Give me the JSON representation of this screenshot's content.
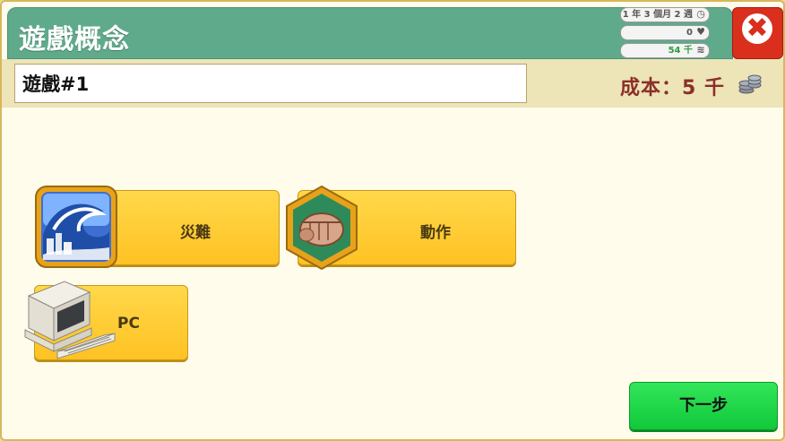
{
  "header": {
    "title": "遊戲概念",
    "date_text": "1 年 3 個月 2 週",
    "hearts": "0",
    "money": "54 千"
  },
  "concept": {
    "name_value": "遊戲#1",
    "cost_text": "成本：5 千"
  },
  "cards": [
    {
      "label": "災難",
      "icon": "wave-icon"
    },
    {
      "label": "動作",
      "icon": "fist-icon"
    },
    {
      "label": "PC",
      "icon": "computer-icon"
    }
  ],
  "footer": {
    "next_label": "下一步"
  },
  "colors": {
    "header_green": "#5faa8b",
    "card_yellow": "#ffd84a",
    "next_green": "#10c93a",
    "close_red": "#d92f1c",
    "cost_red": "#8b2f2a"
  }
}
